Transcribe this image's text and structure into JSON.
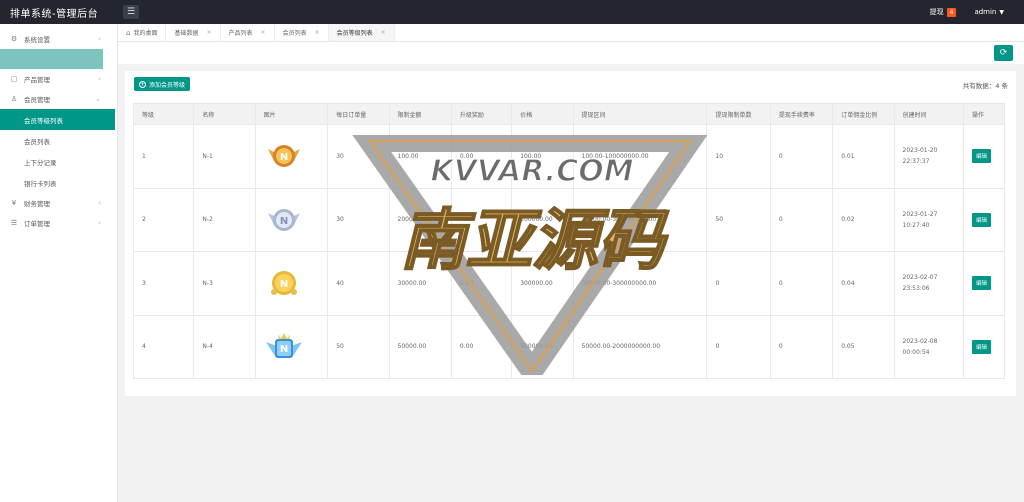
{
  "app": {
    "title": "排单系统-管理后台",
    "menu_icon": "hamburger-icon"
  },
  "header": {
    "withdraw_label": "提现",
    "withdraw_count": "4",
    "user": "admin"
  },
  "sidebar": [
    {
      "label": "系统设置",
      "icon": "gear-icon",
      "arrow": "‹"
    },
    {
      "label": "",
      "highlight": true
    },
    {
      "label": "产品管理",
      "icon": "box-icon",
      "arrow": "‹"
    },
    {
      "label": "会员管理",
      "icon": "user-icon",
      "arrow": "⌄"
    }
  ],
  "sidebar_sub": [
    "会员等级列表",
    "会员列表",
    "上下分记录",
    "银行卡列表"
  ],
  "sidebar_tail": [
    {
      "label": "财务管理",
      "icon": "money-icon",
      "arrow": "‹"
    },
    {
      "label": "订单管理",
      "icon": "order-icon",
      "arrow": "‹"
    }
  ],
  "tabs": [
    {
      "label": "我的桌面",
      "home": true
    },
    {
      "label": "基础数据",
      "close": "×"
    },
    {
      "label": "产品列表",
      "close": "×"
    },
    {
      "label": "会员列表",
      "close": "×"
    },
    {
      "label": "会员等级列表",
      "close": "×",
      "active": true
    }
  ],
  "toolbar": {
    "refresh_icon": "refresh-icon"
  },
  "card": {
    "add_label": "添加会员等级",
    "total_label": "共有数据：4 条"
  },
  "table": {
    "headers": [
      "等级",
      "名称",
      "图片",
      "每日订单量",
      "限制金额",
      "升级奖励",
      "价格",
      "提现区间",
      "提现限制单数",
      "提现手续费率",
      "订单佣金比例",
      "创建时间",
      "操作"
    ],
    "rows": [
      {
        "level": "1",
        "name": "N-1",
        "medal": "gold-winged",
        "daily": "30",
        "limit": "100.00",
        "reward": "0.00",
        "price": "100.00",
        "range": "100.00-100000000.00",
        "wcount": "10",
        "fee": "0",
        "rate": "0.01",
        "created": "2023-01-20 22:37:37",
        "action": "编辑"
      },
      {
        "level": "2",
        "name": "N-2",
        "medal": "silver-winged",
        "daily": "30",
        "limit": "2000.00",
        "reward": "0.00",
        "price": "200000.00",
        "range": "20000.00-300000000.00",
        "wcount": "50",
        "fee": "0",
        "rate": "0.02",
        "created": "2023-01-27 10:27:40",
        "action": "编辑"
      },
      {
        "level": "3",
        "name": "N-3",
        "medal": "gold-round",
        "daily": "40",
        "limit": "30000.00",
        "reward": "0.00",
        "price": "300000.00",
        "range": "30000.00-300000000.00",
        "wcount": "0",
        "fee": "0",
        "rate": "0.04",
        "created": "2023-02-07 23:53:06",
        "action": "编辑"
      },
      {
        "level": "4",
        "name": "N-4",
        "medal": "diamond-winged",
        "daily": "50",
        "limit": "50000.00",
        "reward": "0.00",
        "price": "500000.00",
        "range": "50000.00-2000000000.00",
        "wcount": "0",
        "fee": "0",
        "rate": "0.05",
        "created": "2023-02-08 00:00:54",
        "action": "编辑"
      }
    ]
  },
  "watermark": {
    "line1": "KVVAR.COM",
    "line2": "南亚源码"
  }
}
